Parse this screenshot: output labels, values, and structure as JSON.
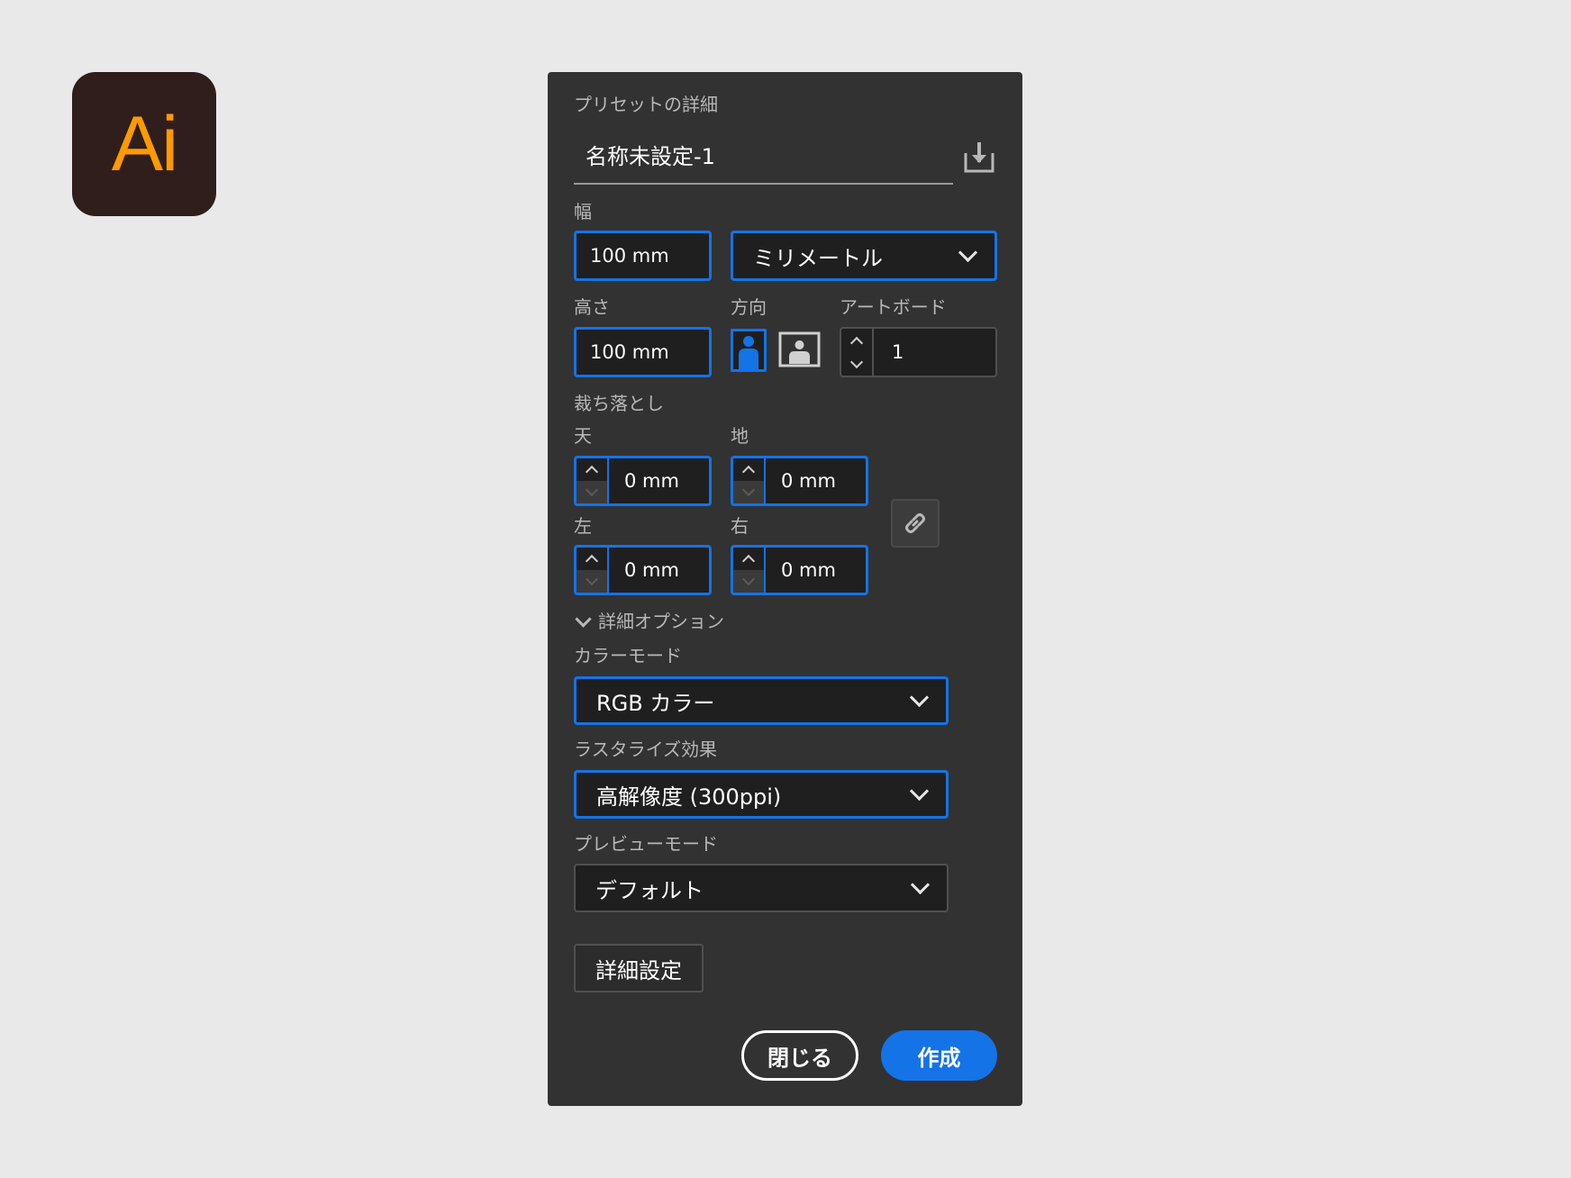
{
  "logo": {
    "text": "Ai"
  },
  "preset": {
    "section_label": "プリセットの詳細",
    "name_value": "名称未設定-1"
  },
  "width": {
    "label": "幅",
    "value": "100 mm",
    "unit": "ミリメートル"
  },
  "height": {
    "label": "高さ",
    "value": "100 mm"
  },
  "orientation": {
    "label": "方向",
    "selected": "portrait"
  },
  "artboards": {
    "label": "アートボード",
    "value": "1"
  },
  "bleed": {
    "label": "裁ち落とし",
    "top": {
      "label": "天",
      "value": "0 mm"
    },
    "bottom": {
      "label": "地",
      "value": "0 mm"
    },
    "left": {
      "label": "左",
      "value": "0 mm"
    },
    "right": {
      "label": "右",
      "value": "0 mm"
    }
  },
  "advanced": {
    "toggle_label": "詳細オプション",
    "color_mode": {
      "label": "カラーモード",
      "value": "RGB カラー"
    },
    "raster_effects": {
      "label": "ラスタライズ効果",
      "value": "高解像度 (300ppi)"
    },
    "preview_mode": {
      "label": "プレビューモード",
      "value": "デフォルト"
    }
  },
  "buttons": {
    "more_settings": "詳細設定",
    "close": "閉じる",
    "create": "作成"
  },
  "colors": {
    "accent": "#1473e6",
    "panel": "#323232",
    "logo_bg": "#2f1e1c",
    "logo_fg": "#ff9a00"
  }
}
